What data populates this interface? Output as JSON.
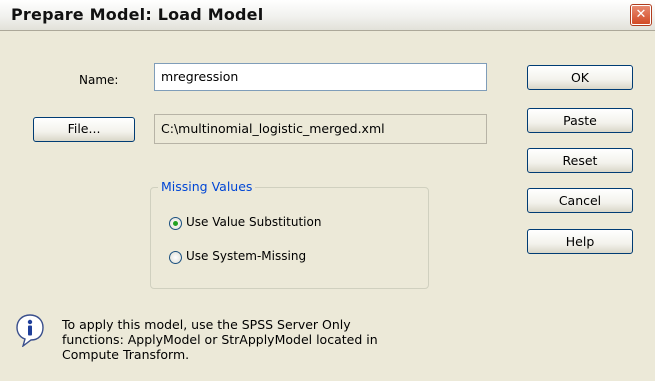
{
  "window": {
    "title": "Prepare Model: Load Model",
    "close_glyph": "✕"
  },
  "form": {
    "name_label": "Name:",
    "name_value": "mregression",
    "file_button": "File...",
    "file_path": "C:\\multinomial_logistic_merged.xml"
  },
  "missing_values": {
    "title": "Missing Values",
    "options": [
      {
        "label": "Use Value Substitution",
        "selected": true
      },
      {
        "label": "Use System-Missing",
        "selected": false
      }
    ]
  },
  "buttons": {
    "ok": "OK",
    "paste": "Paste",
    "reset": "Reset",
    "cancel": "Cancel",
    "help": "Help"
  },
  "info": {
    "icon": "info-icon",
    "lines": [
      "To apply this model, use the SPSS Server Only",
      "functions:  ApplyModel or StrApplyModel located in",
      "Compute Transform."
    ]
  }
}
